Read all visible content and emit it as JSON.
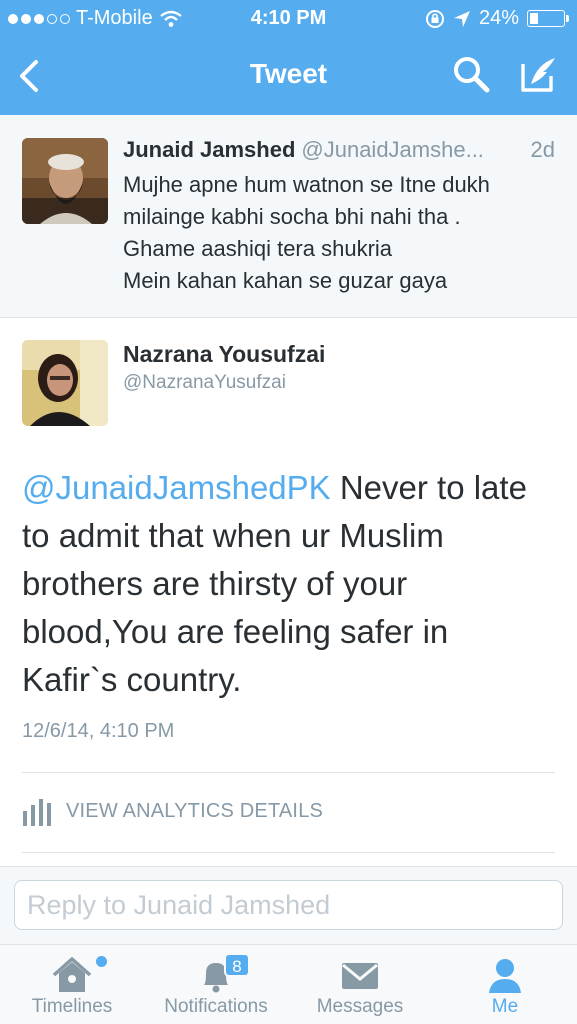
{
  "status_bar": {
    "carrier": "T-Mobile",
    "time": "4:10 PM",
    "battery_percent": "24%",
    "battery_level": 0.24,
    "signal_bars_filled": 3,
    "signal_bars_total": 5
  },
  "nav": {
    "title": "Tweet",
    "back_icon": "chevron-left-icon",
    "search_icon": "search-icon",
    "compose_icon": "compose-icon"
  },
  "parent_tweet": {
    "name": "Junaid Jamshed",
    "handle": "@JunaidJamshe...",
    "time": "2d",
    "lines": [
      "Mujhe apne hum watnon se Itne dukh",
      "milainge kabhi socha bhi nahi tha .",
      "Ghame aashiqi tera shukria",
      "Mein kahan kahan se guzar gaya"
    ]
  },
  "main_tweet": {
    "name": "Nazrana Yousufzai",
    "handle": "@NazranaYusufzai",
    "mention": "@JunaidJamshedPK",
    "line1_rest": " Never to late",
    "lines": [
      "to admit that when ur Muslim",
      "brothers are thirsty of your",
      "blood,You are feeling safer in",
      "Kafir`s country."
    ],
    "timestamp": "12/6/14, 4:10 PM",
    "analytics_label": "VIEW ANALYTICS DETAILS"
  },
  "reply": {
    "placeholder": "Reply to Junaid Jamshed"
  },
  "tabs": [
    {
      "label": "Timelines",
      "icon": "home-icon",
      "active": false,
      "has_dot": true
    },
    {
      "label": "Notifications",
      "icon": "bell-icon",
      "active": false,
      "badge": "8"
    },
    {
      "label": "Messages",
      "icon": "envelope-icon",
      "active": false
    },
    {
      "label": "Me",
      "icon": "person-icon",
      "active": true
    }
  ],
  "colors": {
    "brand": "#55acee",
    "text": "#292f33",
    "muted": "#8899a6",
    "background_alt": "#f5f8fa"
  }
}
